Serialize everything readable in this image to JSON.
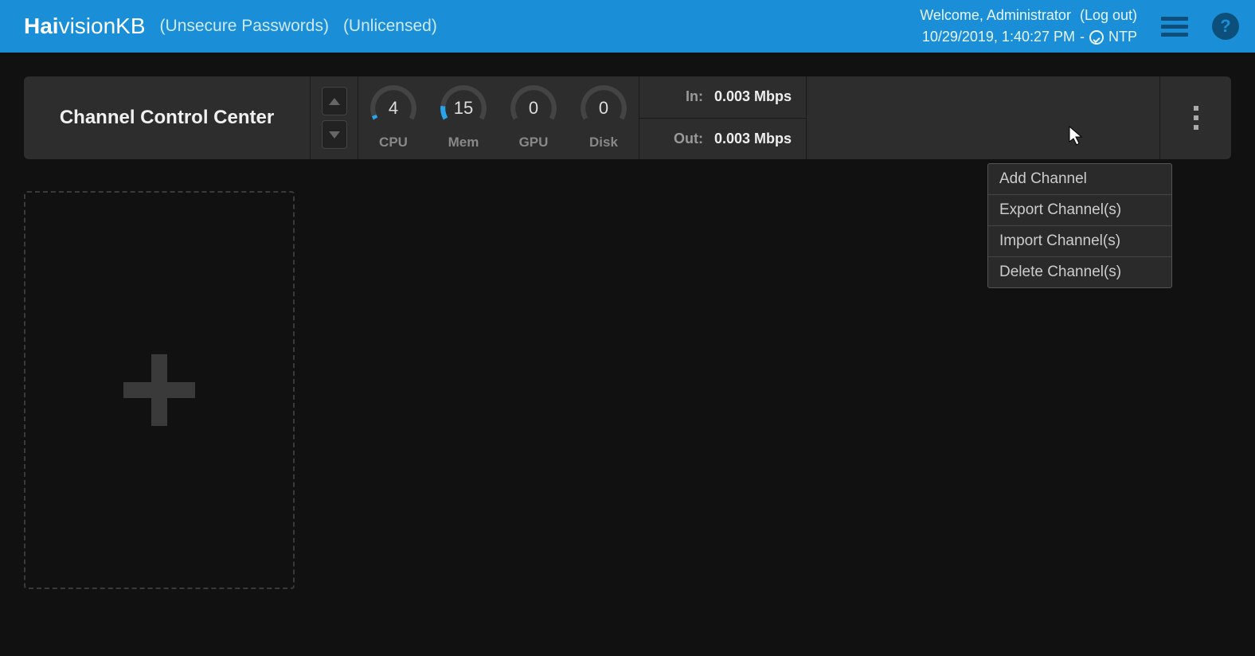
{
  "header": {
    "logo_bold": "Hai",
    "logo_thin": "vision",
    "logo_suffix": " KB",
    "warning_passwords": "(Unsecure Passwords)",
    "warning_license": "(Unlicensed)",
    "welcome": "Welcome, Administrator",
    "logout": "(Log out)",
    "datetime": "10/29/2019, 1:40:27 PM",
    "separator": "-",
    "ntp": "NTP"
  },
  "control": {
    "title": "Channel Control Center",
    "gauges": [
      {
        "label": "CPU",
        "value": "4",
        "pct": 4
      },
      {
        "label": "Mem",
        "value": "15",
        "pct": 15
      },
      {
        "label": "GPU",
        "value": "0",
        "pct": 0
      },
      {
        "label": "Disk",
        "value": "0",
        "pct": 0
      }
    ],
    "in_label": "In:",
    "in_value": "0.003 Mbps",
    "out_label": "Out:",
    "out_value": "0.003 Mbps"
  },
  "menu": {
    "items": [
      "Add Channel",
      "Export Channel(s)",
      "Import Channel(s)",
      "Delete Channel(s)"
    ]
  }
}
